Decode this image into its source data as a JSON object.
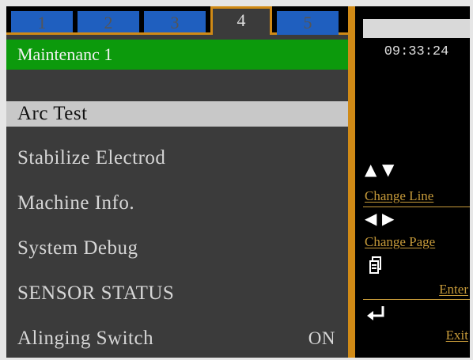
{
  "tabs": [
    {
      "label": "1",
      "active": false
    },
    {
      "label": "2",
      "active": false
    },
    {
      "label": "3",
      "active": false
    },
    {
      "label": "4",
      "active": true
    },
    {
      "label": "5",
      "active": false
    }
  ],
  "screen_title": "Maintenanc 1",
  "menu": [
    {
      "label": "Arc Test",
      "selected": true,
      "value": ""
    },
    {
      "label": "Stabilize Electrod",
      "selected": false,
      "value": ""
    },
    {
      "label": "Machine Info.",
      "selected": false,
      "value": ""
    },
    {
      "label": "System Debug",
      "selected": false,
      "value": ""
    },
    {
      "label": "SENSOR STATUS",
      "selected": false,
      "value": ""
    },
    {
      "label": "Alinging Switch",
      "selected": false,
      "value": "ON"
    }
  ],
  "clock": "09:33:24",
  "side_actions": {
    "change_line": "Change Line",
    "change_page": "Change Page",
    "enter": "Enter",
    "exit": "Exit"
  },
  "icons": {
    "change_line": [
      "arrow-up-icon",
      "arrow-down-icon"
    ],
    "change_page": [
      "arrow-left-icon",
      "arrow-right-icon"
    ],
    "enter": "copy-pages-icon",
    "exit": "return-arrow-icon"
  },
  "colors": {
    "tab_blue": "#1f5fbf",
    "accent_orange": "#d08a16",
    "title_green": "#0c9a0c",
    "panel_gray": "#3b3b3b",
    "selected_row": "#c8c8c8",
    "side_text": "#c69a3a"
  }
}
